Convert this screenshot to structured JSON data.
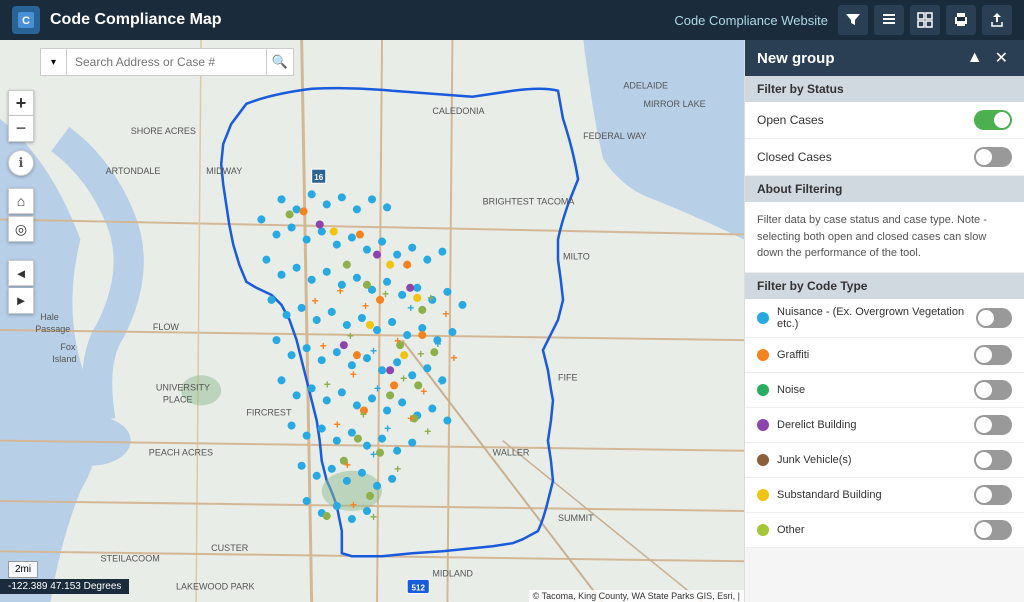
{
  "header": {
    "logo_text": "C",
    "title": "Code Compliance Map",
    "link_text": "Code Compliance Website",
    "tools": [
      {
        "name": "filter-tool",
        "icon": "⚑",
        "label": "Filter"
      },
      {
        "name": "layers-tool",
        "icon": "◧",
        "label": "Layers"
      },
      {
        "name": "basemap-tool",
        "icon": "⊞",
        "label": "Basemap"
      },
      {
        "name": "print-tool",
        "icon": "⎙",
        "label": "Print"
      },
      {
        "name": "share-tool",
        "icon": "↗",
        "label": "Share"
      }
    ]
  },
  "map": {
    "search_placeholder": "Search Address or Case #",
    "zoom_in_label": "+",
    "zoom_out_label": "−",
    "scale_text": "2mi",
    "coordinates_text": "-122.389 47.153 Degrees"
  },
  "right_panel": {
    "title": "New group",
    "collapse_btn": "▲",
    "close_btn": "✕",
    "sections": [
      {
        "id": "filter-by-status",
        "header": "Filter by Status",
        "filters": [
          {
            "label": "Open Cases",
            "toggled": true
          },
          {
            "label": "Closed Cases",
            "toggled": false
          }
        ]
      },
      {
        "id": "about-filtering",
        "header": "About Filtering",
        "text": "Filter data by case status and case type. Note - selecting both open and closed cases can slow down the performance of the tool."
      },
      {
        "id": "filter-by-code-type",
        "header": "Filter by Code Type",
        "types": [
          {
            "label": "Nuisance - (Ex. Overgrown Vegetation etc.)",
            "color": "#29a9e1",
            "toggled": false
          },
          {
            "label": "Graffiti",
            "color": "#f5821f",
            "toggled": false
          },
          {
            "label": "Noise",
            "color": "#27ae60",
            "toggled": false
          },
          {
            "label": "Derelict Building",
            "color": "#8e44ad",
            "toggled": false
          },
          {
            "label": "Junk Vehicle(s)",
            "color": "#8B5E3C",
            "toggled": false
          },
          {
            "label": "Substandard Building",
            "color": "#f1c40f",
            "toggled": false
          },
          {
            "label": "Other",
            "color": "#a4c639",
            "toggled": false
          }
        ]
      }
    ],
    "overgrown_text": "Overgrown"
  },
  "map_labels": {
    "shore_acres": "SHORE ACRES",
    "artondale": "ARTONDALE",
    "midway": "MIDWAY",
    "fox_island": "Fox Island",
    "hale_passage": "Hale Passage",
    "university_place": "UNIVERSITY PLACE",
    "flow": "FLOW",
    "peach_acres": "PEACH ACRES",
    "steilacoom": "STEILACOOM",
    "custer": "CUSTER",
    "lakewood_park": "LAKEWOOD PARK",
    "fircrest": "FIRCREST",
    "waller": "WALLER",
    "fife": "FIFE",
    "milto": "MILTO",
    "summit": "SUMMIT",
    "midland": "MIDLAND",
    "caledonia": "CALEDONIA",
    "federal_way": "FEDERAL WAY",
    "tacoma": "TACOMA",
    "brightest_tacoma": "BRIGHTEST TACOMA",
    "adelaide": "ADELAIDE",
    "mirror_lake": "MIRROR LAKE"
  },
  "attribution_text": "© Tacoma, King County, WA State Parks GIS, Esri, |"
}
